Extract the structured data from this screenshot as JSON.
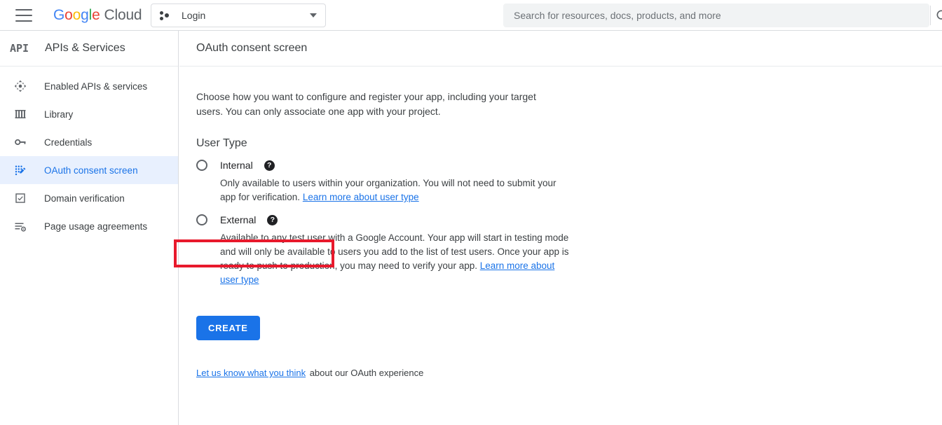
{
  "topbar": {
    "menu_icon": "hamburger-menu-icon",
    "brand": {
      "google": "Google",
      "cloud": "Cloud",
      "letters": [
        "G",
        "o",
        "o",
        "g",
        "l",
        "e"
      ]
    },
    "project_picker": {
      "icon": "project-dots-icon",
      "value": "Login",
      "caret_icon": "chevron-down-icon"
    },
    "search": {
      "placeholder": "Search for resources, docs, products, and more",
      "value": "",
      "icon": "search-icon"
    }
  },
  "sidebar": {
    "logo_text": "API",
    "title": "APIs & Services",
    "items": [
      {
        "label": "Enabled APIs & services",
        "icon": "dashboard-arrows-icon",
        "active": false
      },
      {
        "label": "Library",
        "icon": "library-columns-icon",
        "active": false
      },
      {
        "label": "Credentials",
        "icon": "key-icon",
        "active": false
      },
      {
        "label": "OAuth consent screen",
        "icon": "oauth-consent-icon",
        "active": true
      },
      {
        "label": "Domain verification",
        "icon": "checkbox-icon",
        "active": false
      },
      {
        "label": "Page usage agreements",
        "icon": "list-gear-icon",
        "active": false
      }
    ]
  },
  "page": {
    "title": "OAuth consent screen",
    "intro": "Choose how you want to configure and register your app, including your target users. You can only associate one app with your project.",
    "section_title": "User Type",
    "options": [
      {
        "label": "Internal",
        "selected": false,
        "help_icon": "help-icon",
        "help_glyph": "?",
        "description": "Only available to users within your organization. You will not need to submit your app for verification. ",
        "link": "Learn more about user type",
        "highlighted": false
      },
      {
        "label": "External",
        "selected": false,
        "help_icon": "help-icon",
        "help_glyph": "?",
        "description": "Available to any test user with a Google Account. Your app will start in testing mode and will only be available to users you add to the list of test users. Once your app is ready to push to production, you may need to verify your app. ",
        "link": "Learn more about user type",
        "highlighted": true
      }
    ],
    "create_button": "CREATE",
    "footer": {
      "link": "Let us know what you think",
      "text": " about our OAuth experience"
    }
  },
  "colors": {
    "accent_blue": "#1a73e8",
    "active_nav_bg": "#e8f0fe",
    "annotation_red": "#e8192c",
    "google_blue": "#4285f4",
    "google_red": "#ea4335",
    "google_yellow": "#fbbc05",
    "google_green": "#34a853",
    "text_primary": "#202124",
    "text_secondary": "#5f6368",
    "border": "#dadce0",
    "search_bg": "#f1f3f4"
  }
}
